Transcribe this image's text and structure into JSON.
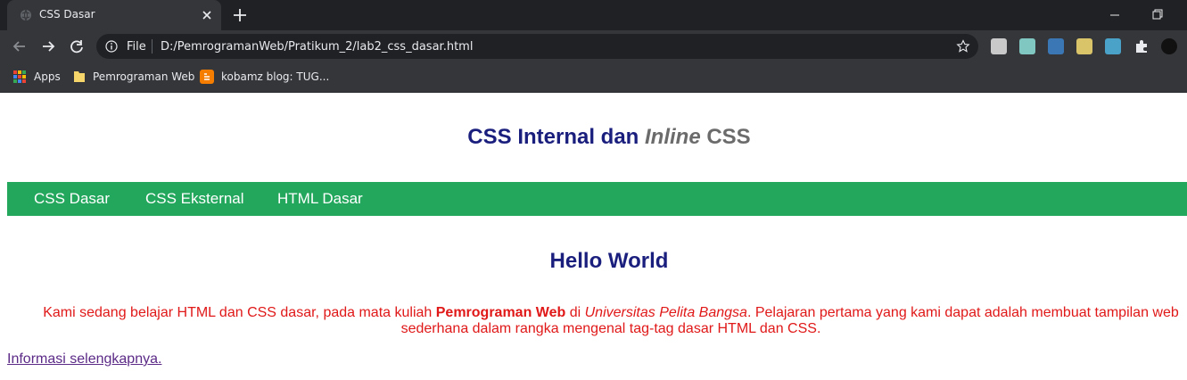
{
  "browser": {
    "tab": {
      "title": "CSS Dasar"
    },
    "address": {
      "scheme": "File",
      "url": "D:/PemrogramanWeb/Pratikum_2/lab2_css_dasar.html"
    },
    "bookmarks": [
      {
        "label": "Apps",
        "icon": "apps-grid-icon"
      },
      {
        "label": "Pemrograman Web",
        "icon": "folder-icon"
      },
      {
        "label": "kobamz blog: TUG...",
        "icon": "blogger-icon"
      }
    ],
    "extensions": [
      "extension-1-icon",
      "extension-2-icon",
      "extension-3-icon",
      "extension-4-icon",
      "extension-5-icon",
      "puzzle-extensions-icon",
      "dark-reader-icon"
    ]
  },
  "page": {
    "title": {
      "part1": "CSS Internal dan ",
      "part2": "Inline",
      "part3": " CSS"
    },
    "nav": [
      "CSS Dasar",
      "CSS Eksternal",
      "HTML Dasar"
    ],
    "heading": "Hello World",
    "paragraph": {
      "t1": "Kami sedang belajar HTML dan CSS dasar, pada mata kuliah ",
      "b1": "Pemrograman Web",
      "t2": " di ",
      "i1": "Universitas Pelita Bangsa",
      "t3": ". Pelajaran pertama yang kami dapat adalah membuat tampilan web sederhana dalam rangka mengenal tag-tag dasar HTML dan CSS."
    },
    "link": "Informasi selengkapnya."
  },
  "colors": {
    "title": "#1a1e7d",
    "title_gray": "#6b6b6b",
    "navbar": "#22a75c",
    "paragraph": "#e01818",
    "link": "#5b2a86"
  }
}
